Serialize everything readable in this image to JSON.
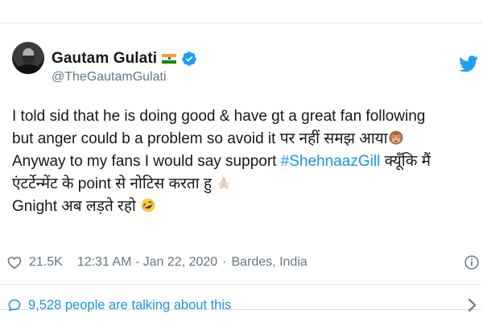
{
  "tweet": {
    "author": {
      "name": "Gautam Gulati",
      "handle": "@TheGautamGulati",
      "verified": true,
      "flag": "india-flag"
    },
    "lines": [
      {
        "text": "I told sid that he is doing good & have gt a great fan following"
      },
      {
        "text": "but anger could b a problem so avoid it पर नहीं समझ आया",
        "emoji": "see-no-evil-monkey-emoji"
      },
      {
        "before": "Anyway to my fans I would say support ",
        "hashtag": "#ShehnaazGill",
        "after": " क्यूँकि मैं"
      },
      {
        "text": "एंटर्टेन्मेंट  के point से नोटिस करता हु ",
        "emoji": "folded-hands-emoji"
      },
      {
        "text": "Gnight अब लड़ते रहो ",
        "emoji": "rolling-laughing-emoji"
      }
    ],
    "likes": "21.5K",
    "time": "12:31 AM - Jan 22, 2020",
    "location": "Bardes, India",
    "talking": "9,528 people are talking about this"
  },
  "colors": {
    "text": "#14171a",
    "secondary": "#657786",
    "link": "#1b95e0",
    "border": "#e1e8ed"
  },
  "icons": {
    "brand": "twitter-bird-icon",
    "verified": "verified-badge-icon",
    "like": "heart-icon",
    "info": "info-icon",
    "reply": "comment-bubble-icon",
    "more": "chevron-right-icon"
  }
}
